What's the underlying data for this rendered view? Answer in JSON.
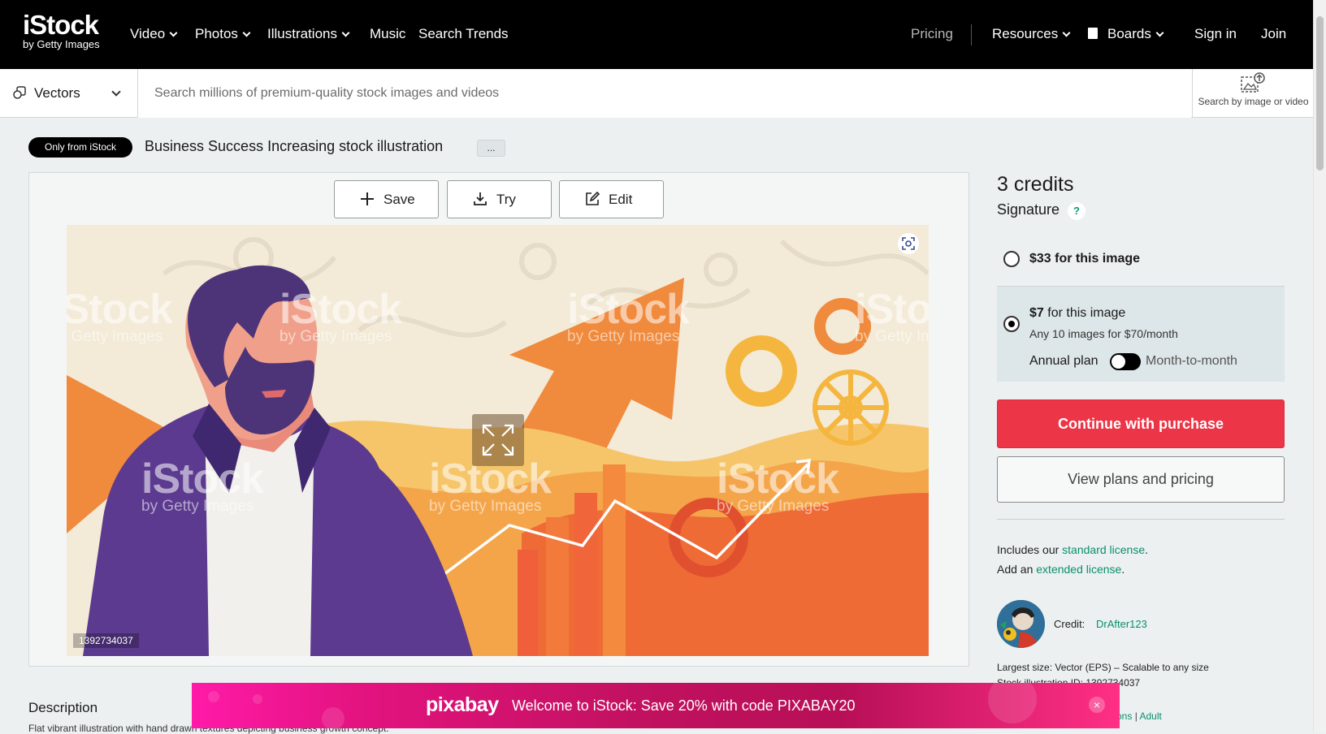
{
  "nav": {
    "logo": "iStock",
    "logo_sub": "by Getty Images",
    "items": [
      {
        "label": "Video"
      },
      {
        "label": "Photos"
      },
      {
        "label": "Illustrations"
      },
      {
        "label": "Music"
      },
      {
        "label": "Search Trends"
      }
    ],
    "pricing": "Pricing",
    "resources": "Resources",
    "boards": "Boards",
    "sign_in": "Sign in",
    "join": "Join"
  },
  "search": {
    "asset_type": "Vectors",
    "placeholder": "Search millions of premium-quality stock images and videos",
    "by_image_label": "Search by image or video"
  },
  "asset": {
    "badge": "Only from iStock",
    "title": "Business Success Increasing stock illustration",
    "more_label": "...",
    "actions": {
      "save": "Save",
      "try": "Try",
      "edit": "Edit"
    },
    "id": "1392734037",
    "watermark": "iStock",
    "watermark_sub": "by Getty Images"
  },
  "sidebar": {
    "credits": "3 credits",
    "tier": "Signature",
    "help": "?",
    "option1": "$33 for this image",
    "option2_price": "$7",
    "option2_rest": "for this image",
    "option2_sub": "Any 10 images for $70/month",
    "annual_plan": "Annual plan",
    "month_to_month": "Month-to-month",
    "purchase_button": "Continue with purchase",
    "plans_button": "View plans and pricing",
    "includes_prefix": "Includes our",
    "standard_license": "standard license",
    "add_prefix": "Add an",
    "extended_license": "extended license",
    "credit_label": "Credit:",
    "credit_name": "DrAfter123",
    "largest_size": "Largest size: Vector (EPS) – Scalable to any size",
    "stock_id": "Stock illustration ID: 1392734037",
    "links_partial": "ons",
    "links_sep": "|",
    "links_adult": "Adult"
  },
  "description": {
    "heading": "Description",
    "text": "Flat vibrant illustration with hand drawn textures depicting business growth concept."
  },
  "promo": {
    "logo": "pixabay",
    "text": "Welcome to iStock: Save 20% with code PIXABAY20",
    "close": "×"
  },
  "colors": {
    "accent_red": "#ec3547",
    "link_green": "#0a8f6a",
    "nav_bg": "#000000",
    "promo_pink": "#e3137f"
  },
  "icons": [
    "chevron-down-icon",
    "boards-icon",
    "vectors-icon",
    "search-by-image-icon",
    "plus-icon",
    "download-icon",
    "edit-icon",
    "expand-icon",
    "focus-icon",
    "help-icon",
    "close-icon"
  ]
}
